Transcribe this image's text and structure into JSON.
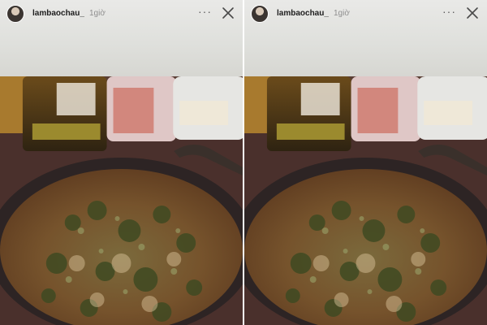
{
  "stories": [
    {
      "username": "lambaochau_",
      "time": "1giờ",
      "more_label": "···",
      "close_icon": "close-icon",
      "avatar_icon": "avatar"
    },
    {
      "username": "lambaochau_",
      "time": "1giờ",
      "more_label": "···",
      "close_icon": "close-icon",
      "avatar_icon": "avatar"
    }
  ],
  "colors": {
    "soup": "#7a5a2d",
    "pan": "#2d2424",
    "background": "#dedfdb"
  }
}
